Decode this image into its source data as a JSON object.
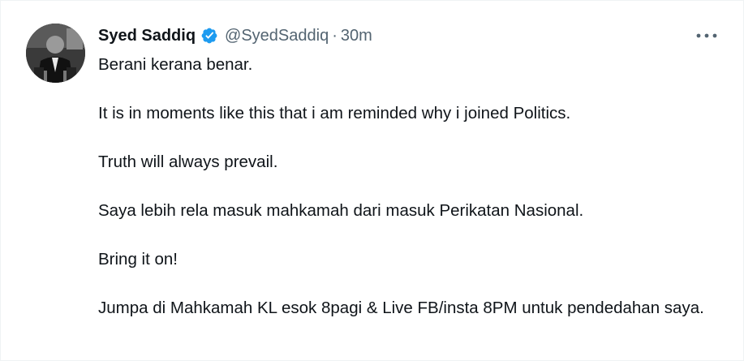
{
  "tweet": {
    "author": {
      "name": "Syed Saddiq",
      "handle": "@SyedSaddiq",
      "verified": true
    },
    "separator": "·",
    "time": "30m",
    "paragraphs": [
      "Berani kerana benar.",
      "It is in moments like this that i am reminded why i joined Politics.",
      "Truth will always prevail.",
      "Saya lebih rela masuk mahkamah dari masuk Perikatan Nasional.",
      "Bring it on!",
      "Jumpa di Mahkamah KL esok 8pagi & Live FB/insta 8PM untuk pendedahan saya."
    ]
  },
  "colors": {
    "text": "#0f1419",
    "secondary": "#536471",
    "verified_blue": "#1d9bf0",
    "border": "#eff3f4"
  },
  "icons": {
    "verified": "verified-badge-icon",
    "more": "more-options-icon"
  }
}
